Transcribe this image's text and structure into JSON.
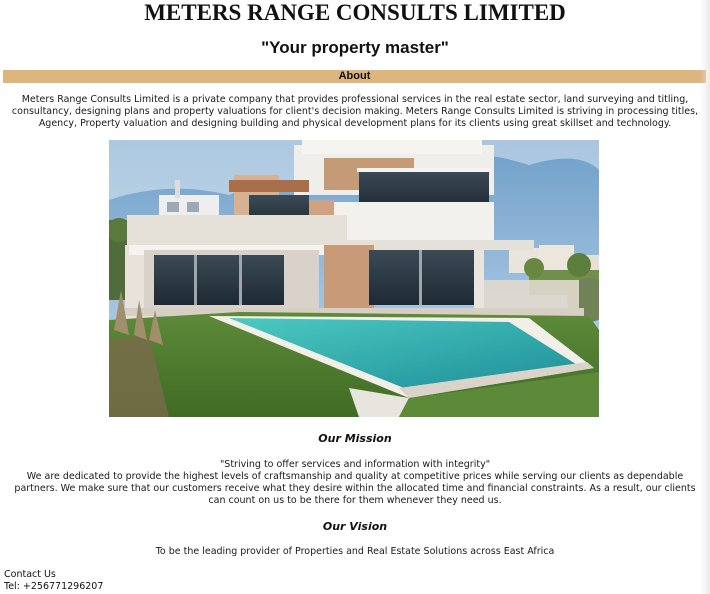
{
  "header": {
    "company_name": "METERS RANGE CONSULTS LIMITED",
    "tagline": "\"Your property master\""
  },
  "about": {
    "heading": "About",
    "text": "Meters Range Consults Limited is a private company that provides professional services in the real estate sector, land surveying and titling, consultancy, designing plans and property valuations for client's decision making. Meters Range Consults Limited is striving in processing titles, Agency, Property valuation and designing building and physical development plans for its clients using great skillset and technology."
  },
  "hero_image": {
    "alt": "Modern villa with swimming pool"
  },
  "mission": {
    "heading": "Our Mission",
    "quote": "\"Striving to offer services and information with integrity\"",
    "text": "We are dedicated to provide the highest levels of craftsmanship and quality at competitive prices while serving our clients as dependable partners. We make sure that our customers receive what they desire within the allocated time and financial constraints. As a result, our clients can count on us to be there for them whenever they need us."
  },
  "vision": {
    "heading": "Our Vision",
    "text": "To be the leading provider of Properties and Real Estate Solutions across East Africa"
  },
  "contact": {
    "heading": "Contact Us",
    "tel": "Tel: +256771296207"
  }
}
